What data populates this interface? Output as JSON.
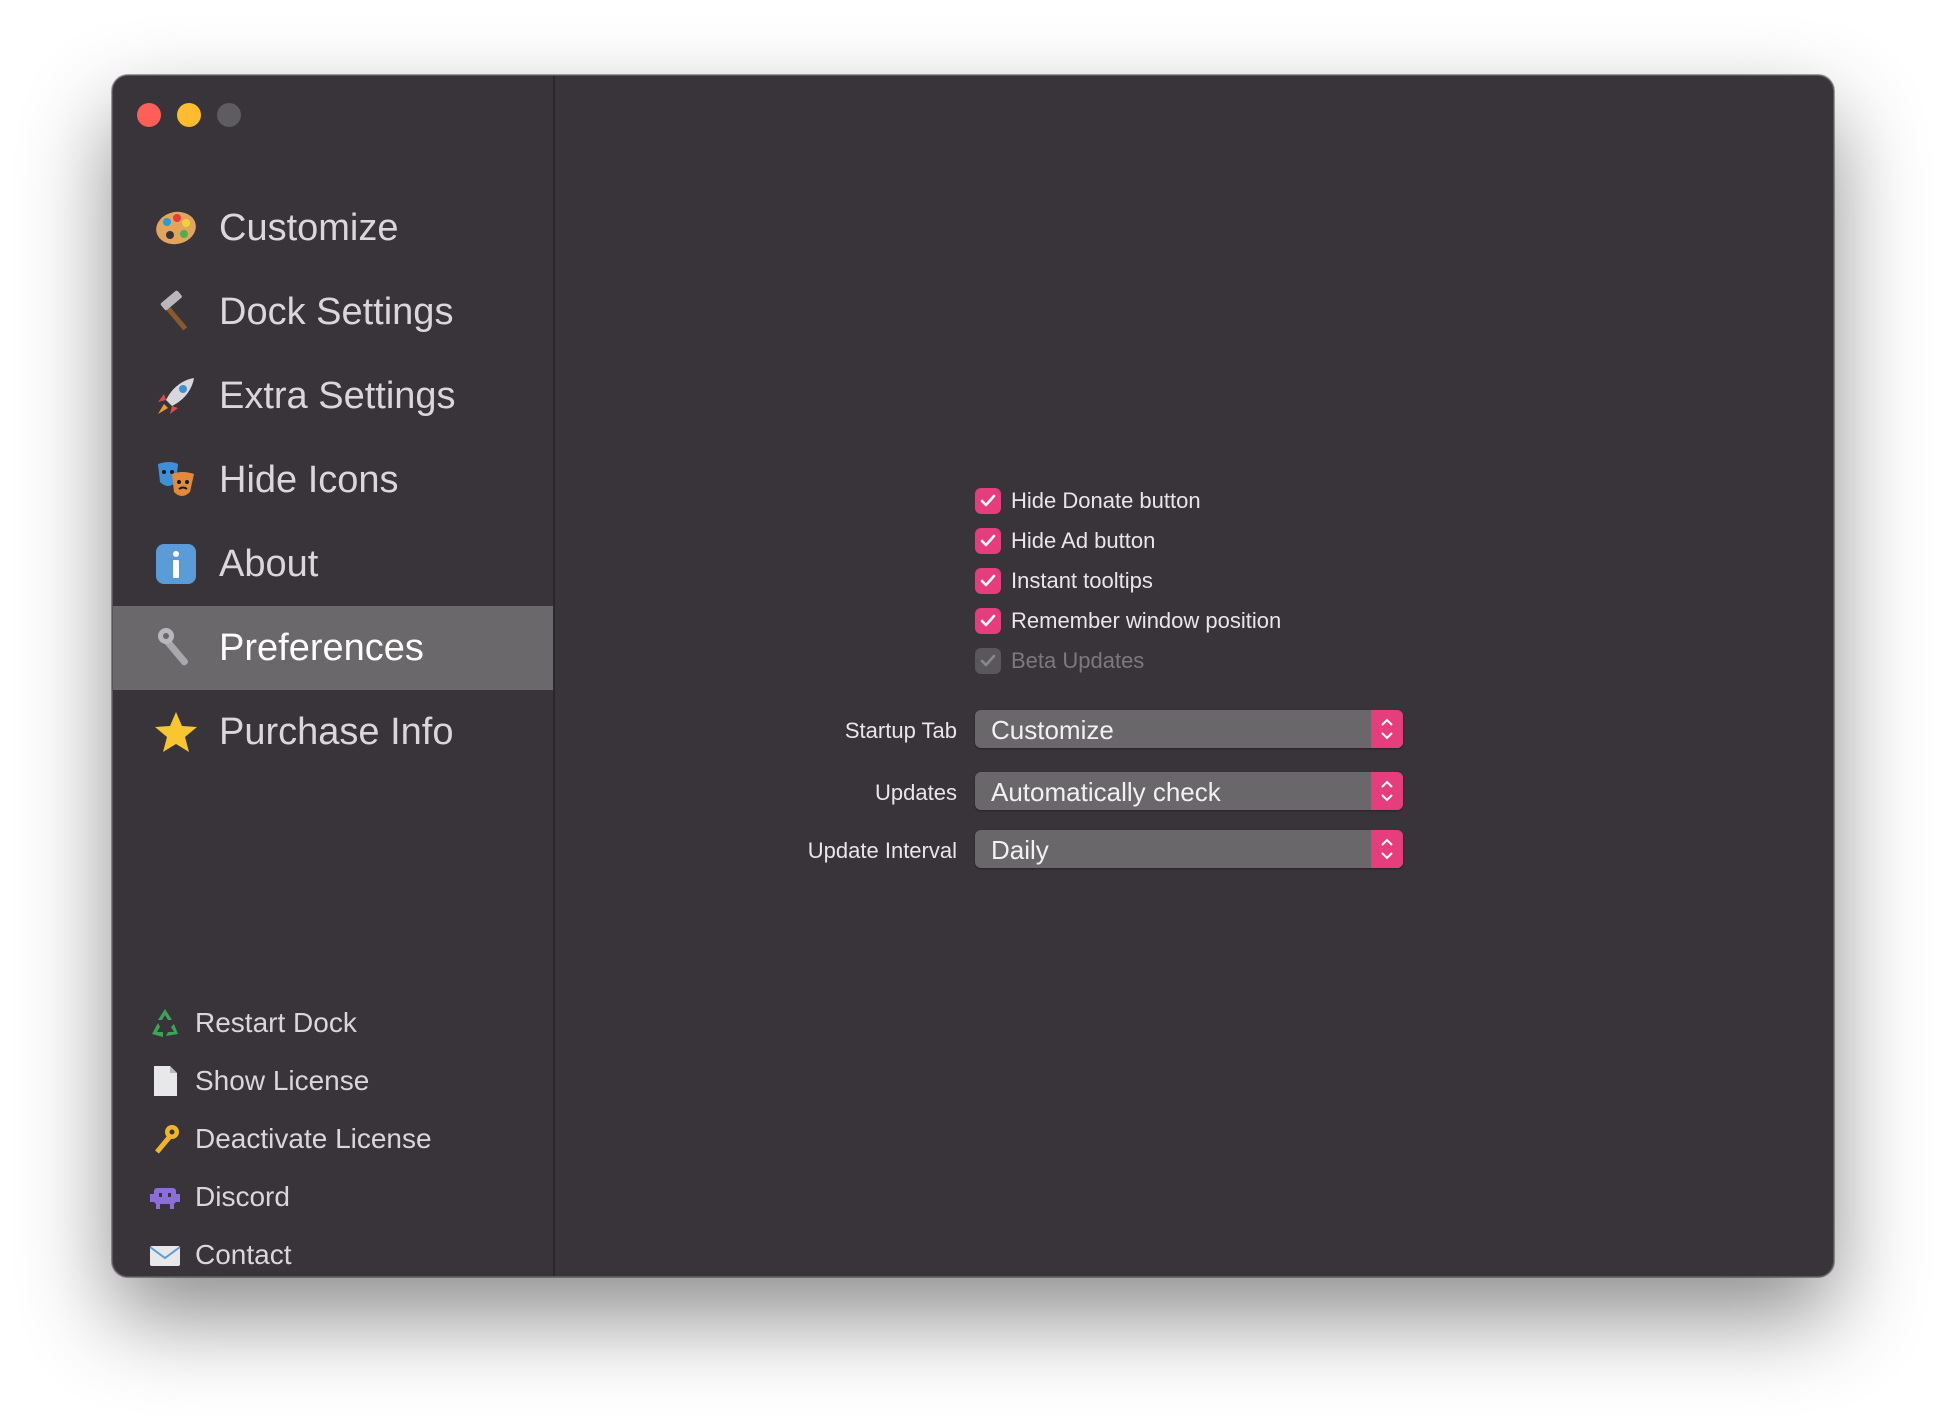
{
  "window": {
    "controls": [
      "close",
      "minimize",
      "zoom"
    ]
  },
  "sidebar": {
    "items": [
      {
        "label": "Customize",
        "icon": "palette-icon"
      },
      {
        "label": "Dock Settings",
        "icon": "hammer-icon"
      },
      {
        "label": "Extra Settings",
        "icon": "rocket-icon"
      },
      {
        "label": "Hide Icons",
        "icon": "theater-masks-icon"
      },
      {
        "label": "About",
        "icon": "info-icon"
      },
      {
        "label": "Preferences",
        "icon": "wrench-icon",
        "active": true
      },
      {
        "label": "Purchase Info",
        "icon": "star-icon"
      }
    ],
    "links": [
      {
        "label": "Restart Dock",
        "icon": "recycle-icon"
      },
      {
        "label": "Show License",
        "icon": "document-icon"
      },
      {
        "label": "Deactivate License",
        "icon": "key-icon"
      },
      {
        "label": "Discord",
        "icon": "space-invader-icon"
      },
      {
        "label": "Contact",
        "icon": "envelope-icon"
      }
    ]
  },
  "preferences": {
    "checkboxes": [
      {
        "label": "Hide Donate button",
        "checked": true,
        "enabled": true
      },
      {
        "label": "Hide Ad button",
        "checked": true,
        "enabled": true
      },
      {
        "label": "Instant tooltips",
        "checked": true,
        "enabled": true
      },
      {
        "label": "Remember window position",
        "checked": true,
        "enabled": true
      },
      {
        "label": "Beta Updates",
        "checked": true,
        "enabled": false
      }
    ],
    "startup_tab": {
      "label": "Startup Tab",
      "value": "Customize"
    },
    "updates": {
      "label": "Updates",
      "value": "Automatically check"
    },
    "update_interval": {
      "label": "Update Interval",
      "value": "Daily"
    }
  },
  "colors": {
    "accent": "#e63d7d",
    "background": "#38343a",
    "selected": "#6b686c"
  }
}
